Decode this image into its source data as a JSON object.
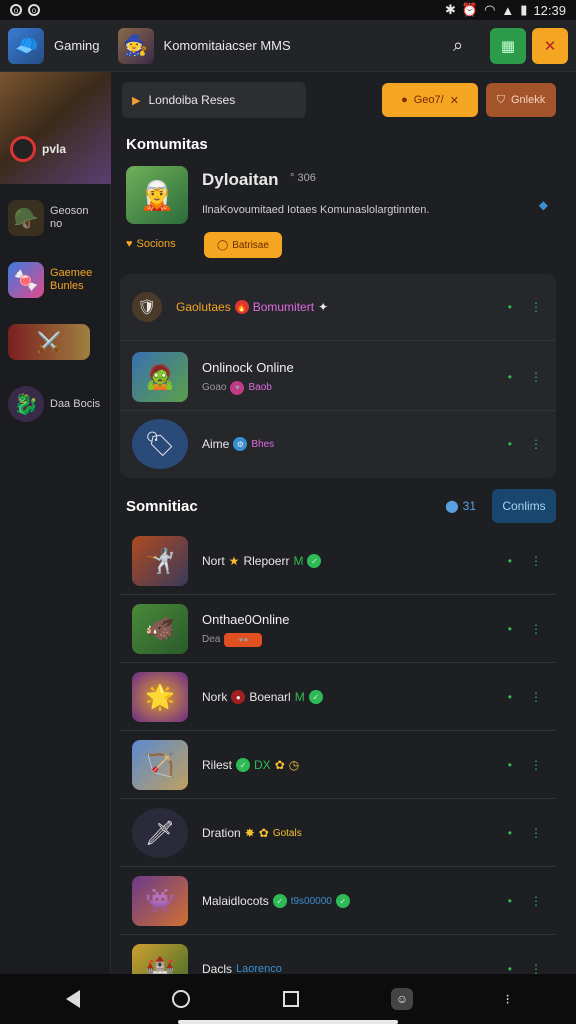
{
  "status": {
    "time": "12:39"
  },
  "header": {
    "user_name": "Gaming",
    "title": "Komomitaiacser MMS",
    "grid_label": "▦",
    "close_label": "✕"
  },
  "sidebar": {
    "banner_label": "pvla",
    "items": [
      {
        "icon": "🪖",
        "label": "Geoson no"
      },
      {
        "icon": "🍬",
        "label": "Gaemee Bunles"
      },
      {
        "icon": "⚔️",
        "label": ""
      },
      {
        "icon": "🐉",
        "label": "Daa Bocis"
      }
    ]
  },
  "topbar": {
    "search_label": "Londoiba Reses",
    "yellow_btn": "Geo7/",
    "brown_btn": "Gnlekk"
  },
  "section1": {
    "title": "Komumitas"
  },
  "feature": {
    "title": "Dyloaitan",
    "meta": "306",
    "desc": "IlnaKovoumitaed Iotaes Komunaslolargtinnten.",
    "link": "Socions",
    "button": "Batrisae"
  },
  "card1_rows": [
    {
      "name": "Gaolutaes",
      "tag": "Bomumitert"
    },
    {
      "name": "Onlinock Online",
      "sub": "Goao",
      "tag": "Baob"
    },
    {
      "name": "Aime",
      "tag": "Bhes"
    }
  ],
  "section2": {
    "title": "Somnitiac",
    "count": "31",
    "button": "Conlims"
  },
  "list2_rows": [
    {
      "name": "Nort",
      "tag": "Rlepoerr",
      "extra": "M"
    },
    {
      "name": "Onthae0Online",
      "sub": "Dea",
      "tag": ""
    },
    {
      "name": "Nork",
      "tag": "Boenarl",
      "extra": "M"
    },
    {
      "name": "Rilest",
      "tag": "DX",
      "extra": ""
    },
    {
      "name": "Dration",
      "tag": "Gotals",
      "extra": ""
    },
    {
      "name": "Malaidlocots",
      "tag": "t9s00000",
      "extra": ""
    },
    {
      "name": "Dacls",
      "tag": "Laorenco",
      "extra": ""
    }
  ],
  "colors": {
    "accent_orange": "#f4a521",
    "accent_green": "#2dbb55",
    "accent_blue": "#18466e"
  }
}
